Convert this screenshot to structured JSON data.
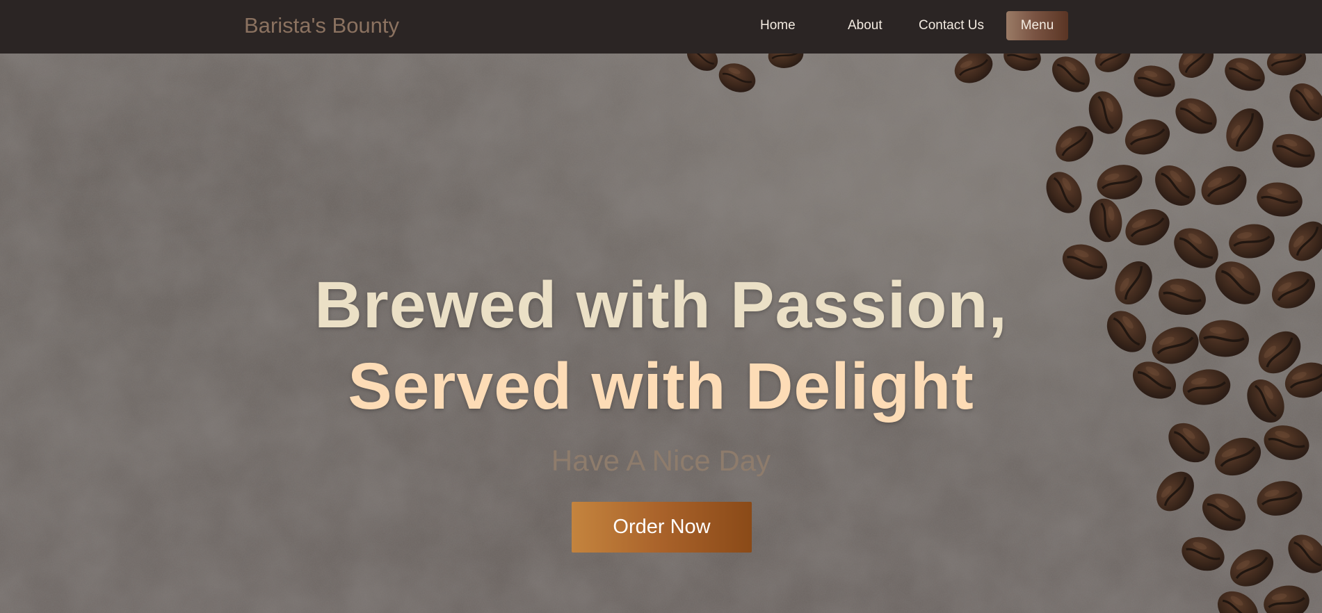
{
  "header": {
    "brand": "Barista's Bounty",
    "nav": {
      "home": "Home",
      "about": "About",
      "contact": "Contact Us",
      "menu": "Menu"
    }
  },
  "hero": {
    "headline_line1": "Brewed with Passion,",
    "headline_line2": "Served with Delight",
    "tagline": "Have A Nice Day",
    "cta": "Order Now"
  },
  "colors": {
    "navbar_bg": "#2b2524",
    "brand_text": "#8b7260",
    "nav_text": "#f4ece2",
    "headline_line1": "#ebe0c6",
    "headline_line2": "#fddcb6",
    "tagline": "#8e7c6c",
    "cta_gradient_start": "#c4843e",
    "cta_gradient_end": "#8a4a18"
  }
}
